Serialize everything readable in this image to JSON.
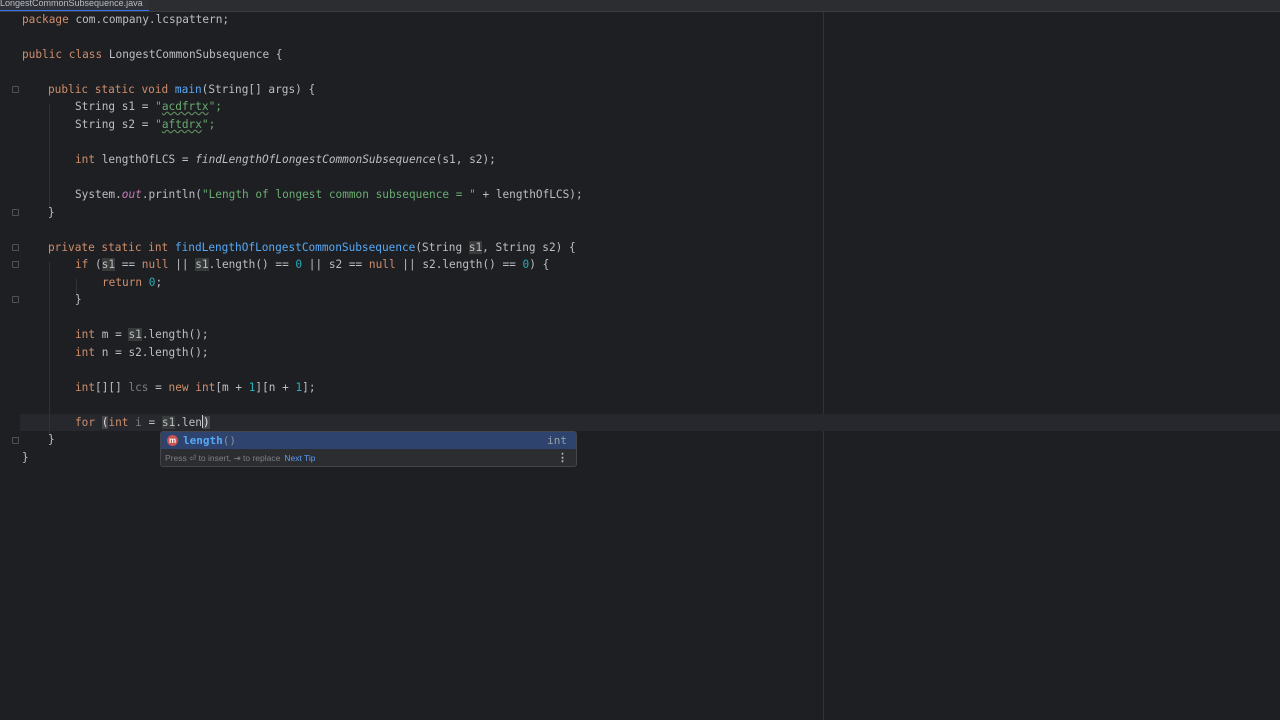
{
  "tab": {
    "file_name": "LongestCommonSubsequence.java"
  },
  "code": {
    "l1_kw": "package",
    "l1_rest": " com.company.lcspattern;",
    "l3_kw": "public class",
    "l3_rest": " LongestCommonSubsequence {",
    "l5_kw": "public static void",
    "l5_fn": "main",
    "l5_rest": "(String[] args) {",
    "l6_pre": "String s1 = ",
    "l6_q1": "\"",
    "l6_str": "acdfrtx",
    "l6_q2": "\";",
    "l7_pre": "String s2 = ",
    "l7_q1": "\"",
    "l7_str": "aftdrx",
    "l7_q2": "\";",
    "l9_kw": "int",
    "l9_var": " lengthOfLCS = ",
    "l9_call": "findLengthOfLongestCommonSubsequence",
    "l9_rest": "(s1, s2);",
    "l11_pre": "System.",
    "l11_out": "out",
    "l11_mid": ".println(",
    "l11_str": "\"Length of longest common subsequence = \"",
    "l11_rest": " + lengthOfLCS);",
    "l12_brace": "}",
    "l14_kw": "private static int",
    "l14_fn": "findLengthOfLongestCommonSubsequence",
    "l14_a": "(String ",
    "l14_s1": "s1",
    "l14_b": ", String s2) {",
    "l15_if": "if",
    "l15_a": " (",
    "l15_s1a": "s1",
    "l15_b": " == ",
    "l15_null1": "null",
    "l15_c": " || ",
    "l15_s1b": "s1",
    "l15_d": ".length() == ",
    "l15_zero1": "0",
    "l15_e": " || s2 == ",
    "l15_null2": "null",
    "l15_f": " || s2.length() == ",
    "l15_zero2": "0",
    "l15_g": ") {",
    "l16_kw": "return",
    "l16_num": "0",
    "l16_end": ";",
    "l17_brace": "}",
    "l19_kw": "int",
    "l19_a": " m = ",
    "l19_s1": "s1",
    "l19_b": ".length();",
    "l20_kw": "int",
    "l20_rest": " n = s2.length();",
    "l22_kw": "int",
    "l22_a": "[][] ",
    "l22_lcs": "lcs",
    "l22_b": " = ",
    "l22_new": "new int",
    "l22_c": "[m + ",
    "l22_one1": "1",
    "l22_d": "][n + ",
    "l22_one2": "1",
    "l22_e": "];",
    "l24_for": "for",
    "l24_paren": "(",
    "l24_int": "int",
    "l24_i": "i",
    "l24_a": " = ",
    "l24_s1": "s1",
    "l24_b": ".len",
    "l24_close": ")",
    "l25_brace": "}",
    "l26_brace": "}"
  },
  "completion": {
    "badge": "m",
    "name_match": "length",
    "args": "()",
    "type": "int",
    "footer": "Press ⏎ to insert, ⇥ to replace",
    "next_tip": "Next Tip",
    "more": "⋮"
  }
}
